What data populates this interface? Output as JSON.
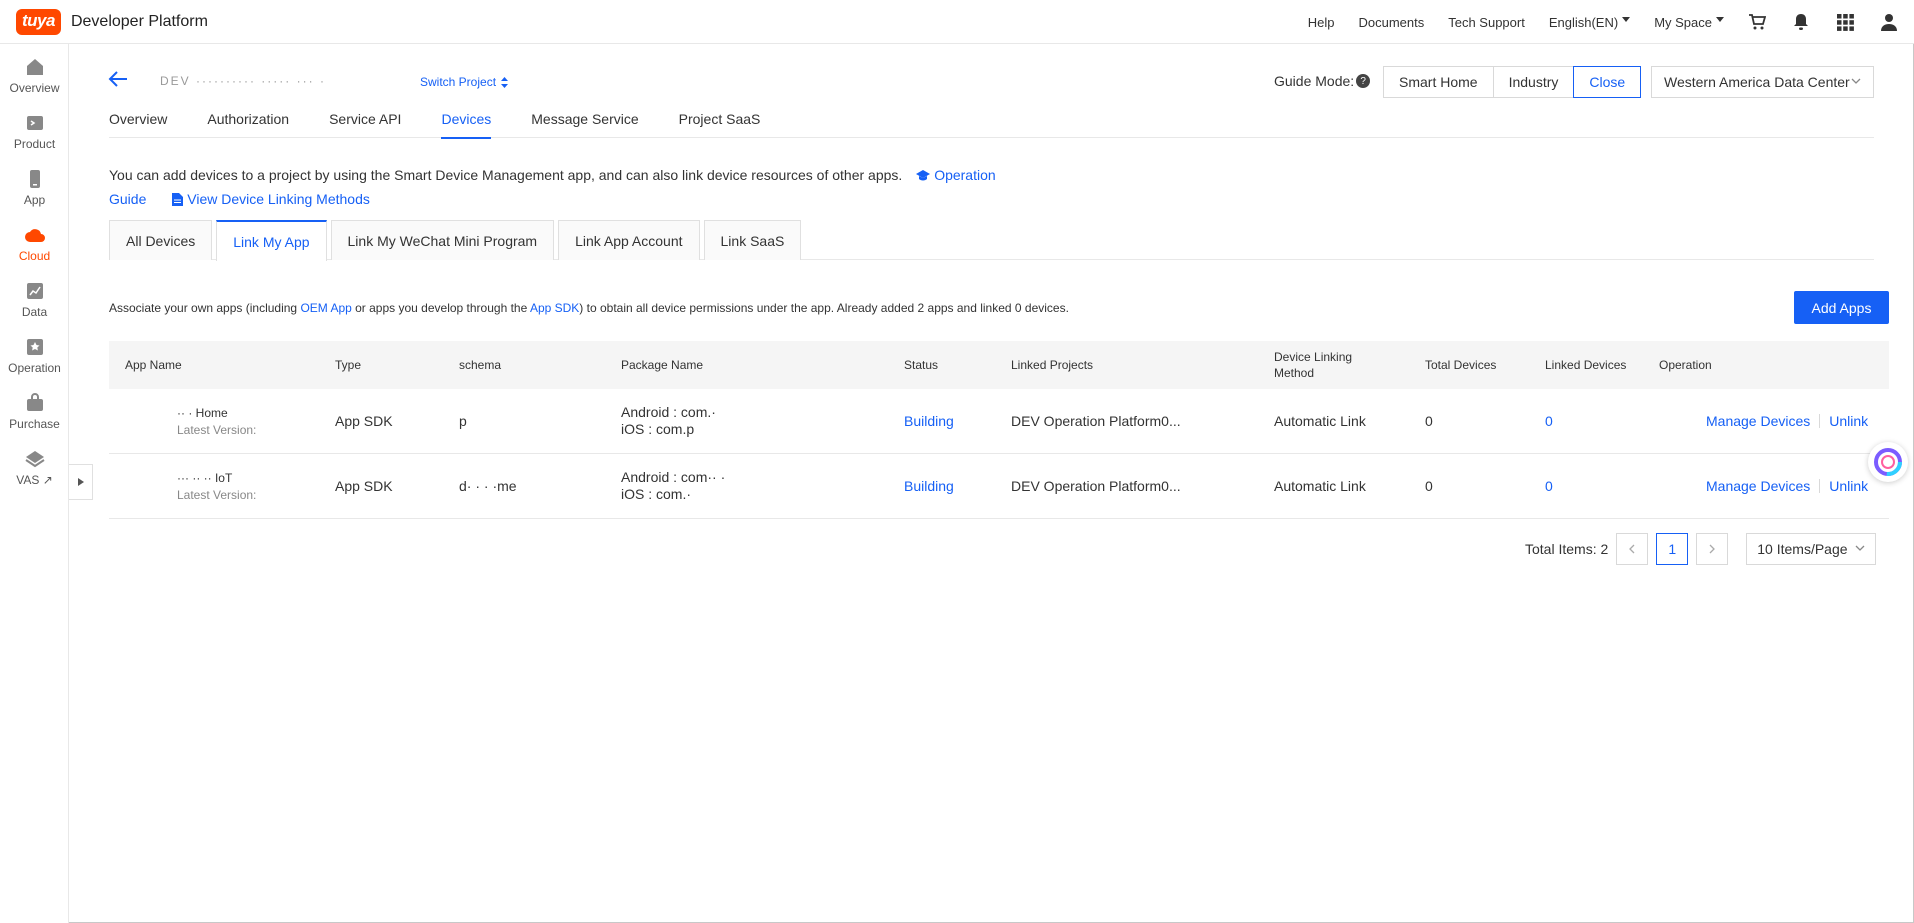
{
  "app": {
    "brand": "tuya",
    "title": "Developer Platform"
  },
  "topnav": {
    "help": "Help",
    "documents": "Documents",
    "tech_support": "Tech Support",
    "language": "English(EN)",
    "my_space": "My Space"
  },
  "sidebar": {
    "items": [
      {
        "label": "Overview",
        "icon": "home-icon"
      },
      {
        "label": "Product",
        "icon": "product-icon"
      },
      {
        "label": "App",
        "icon": "app-icon"
      },
      {
        "label": "Cloud",
        "icon": "cloud-icon"
      },
      {
        "label": "Data",
        "icon": "chart-icon"
      },
      {
        "label": "Operation",
        "icon": "operation-icon"
      },
      {
        "label": "Purchase",
        "icon": "purchase-icon"
      },
      {
        "label": "VAS",
        "icon": "vas-icon"
      }
    ]
  },
  "header": {
    "project_name": "DEV ·········· ····· ··· ·",
    "switch_project": "Switch Project",
    "guide_mode_label": "Guide Mode:",
    "guide_options": [
      "Smart Home",
      "Industry",
      "Close"
    ],
    "data_center": "Western America Data Center"
  },
  "main_tabs": [
    "Overview",
    "Authorization",
    "Service API",
    "Devices",
    "Message Service",
    "Project SaaS"
  ],
  "intro": {
    "text": "You can add devices to a project by using the Smart Device Management app, and can also link device resources of other apps.",
    "operation_guide_1": "Operation",
    "operation_guide_2": "Guide",
    "view_methods": "View Device Linking Methods"
  },
  "sub_tabs": [
    "All Devices",
    "Link My App",
    "Link My WeChat Mini Program",
    "Link App Account",
    "Link SaaS"
  ],
  "assoc": {
    "part1": "Associate your own apps (including ",
    "oem_app": "OEM App",
    "part2": " or apps you develop through the ",
    "app_sdk": "App SDK",
    "part3": ") to obtain all device permissions under the app. Already added 2 apps and linked 0 devices."
  },
  "add_apps": "Add Apps",
  "table": {
    "headers": {
      "app_name": "App Name",
      "type": "Type",
      "schema": "schema",
      "package": "Package Name",
      "status": "Status",
      "linked_projects": "Linked Projects",
      "method": "Device Linking Method",
      "total": "Total Devices",
      "linked": "Linked Devices",
      "operation": "Operation"
    },
    "rows": [
      {
        "name": "·· · Home",
        "version": "Latest Version:",
        "type": "App SDK",
        "schema": "p",
        "android": "Android : com.·",
        "ios": "iOS : com.p",
        "status": "Building",
        "project": "DEV Operation Platform0...",
        "method": "Automatic Link",
        "total": "0",
        "linked": "0",
        "manage": "Manage Devices",
        "unlink": "Unlink"
      },
      {
        "name": "··· ·· ·· IoT",
        "version": "Latest Version:",
        "type": "App SDK",
        "schema": "d·  ·  ·   ·me",
        "android": "Android : com·· ·",
        "ios": "iOS : com.·",
        "status": "Building",
        "project": "DEV Operation Platform0...",
        "method": "Automatic Link",
        "total": "0",
        "linked": "0",
        "manage": "Manage Devices",
        "unlink": "Unlink"
      }
    ]
  },
  "pagination": {
    "total_label": "Total Items: 2",
    "current_page": "1",
    "per_page": "10 Items/Page"
  },
  "colors": {
    "brand": "#ff4800",
    "accent": "#1660f5"
  }
}
